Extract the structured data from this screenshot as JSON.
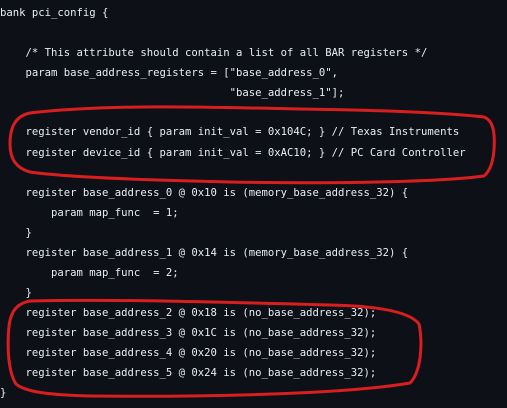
{
  "code": {
    "language": "dml",
    "lines": [
      "bank pci_config {",
      "",
      "    /* This attribute should contain a list of all BAR registers */",
      "    param base_address_registers = [\"base_address_0\",",
      "                                    \"base_address_1\"];",
      "",
      "    register vendor_id { param init_val = 0x104C; } // Texas Instruments",
      "    register device_id { param init_val = 0xAC10; } // PC Card Controller",
      "",
      "    register base_address_0 @ 0x10 is (memory_base_address_32) {",
      "        param map_func  = 1;",
      "    }",
      "    register base_address_1 @ 0x14 is (memory_base_address_32) {",
      "        param map_func  = 2;",
      "    }",
      "    register base_address_2 @ 0x18 is (no_base_address_32);",
      "    register base_address_3 @ 0x1C is (no_base_address_32);",
      "    register base_address_4 @ 0x20 is (no_base_address_32);",
      "    register base_address_5 @ 0x24 is (no_base_address_32);",
      "}"
    ]
  },
  "colors": {
    "background": "#0d1117",
    "text": "#e6edf3",
    "annotation": "#d81e1e"
  }
}
